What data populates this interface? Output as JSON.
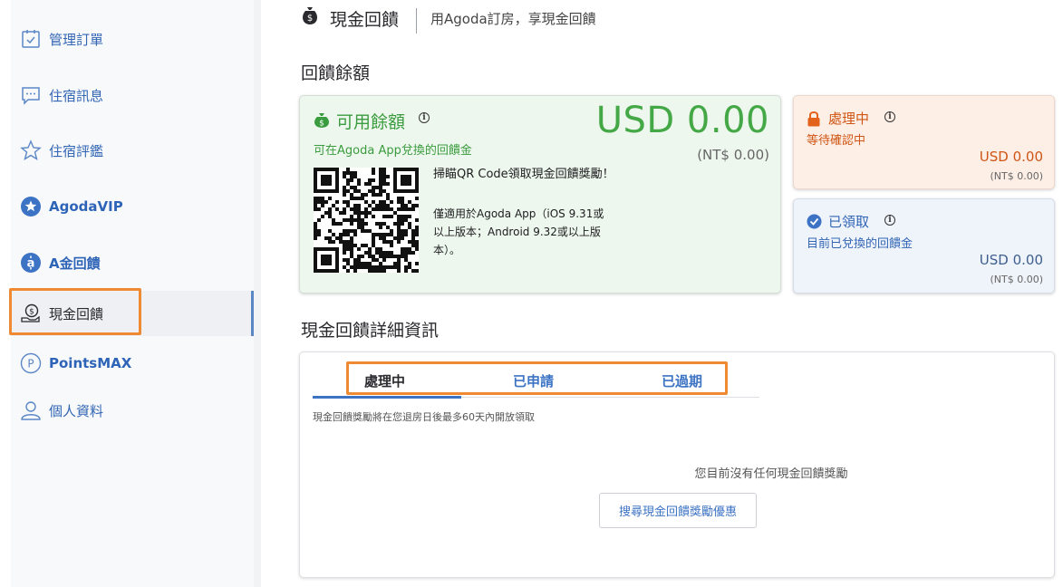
{
  "sidebar": {
    "items": [
      {
        "label": "管理訂單",
        "icon": "checklist-icon"
      },
      {
        "label": "住宿訊息",
        "icon": "chat-icon"
      },
      {
        "label": "住宿評鑑",
        "icon": "star-outline-icon"
      },
      {
        "label": "AgodaVIP",
        "icon": "vip-star-badge-icon"
      },
      {
        "label": "A金回饋",
        "icon": "coin-badge-icon"
      },
      {
        "label": "現金回饋",
        "icon": "cash-hand-icon"
      },
      {
        "label": "PointsMAX",
        "icon": "points-icon"
      },
      {
        "label": "個人資料",
        "icon": "person-icon"
      }
    ],
    "active_index": 5
  },
  "header": {
    "title": "現金回饋",
    "subtitle": "用Agoda訂房，享現金回饋"
  },
  "balance": {
    "section_title": "回饋餘額",
    "available": {
      "label": "可用餘額",
      "amount": "USD 0.00",
      "amount_local": "(NT$ 0.00)",
      "description": "可在Agoda App兌換的回饋金",
      "scan_text": "掃瞄QR Code領取現金回饋獎勵！",
      "ios_text": "僅適用於Agoda App（iOS 9.31或以上版本；Android 9.32或以上版本）。"
    },
    "processing": {
      "label": "處理中",
      "description": "等待確認中",
      "amount": "USD 0.00",
      "amount_local": "(NT$ 0.00)"
    },
    "received": {
      "label": "已領取",
      "description": "目前已兌換的回饋金",
      "amount": "USD 0.00",
      "amount_local": "(NT$ 0.00)"
    }
  },
  "details": {
    "section_title": "現金回饋詳細資訊",
    "tabs": [
      {
        "label": "處理中",
        "active": true
      },
      {
        "label": "已申請",
        "active": false
      },
      {
        "label": "已過期",
        "active": false
      }
    ],
    "note": "現金回饋獎勵將在您退房日後最多60天內開放領取",
    "empty_message": "您目前沒有任何現金回饋獎勵",
    "search_button": "搜尋現金回饋獎勵優惠"
  },
  "colors": {
    "brand_blue": "#3266b5",
    "green": "#45a846",
    "orange": "#cf5614",
    "highlight": "#ef8a32"
  }
}
